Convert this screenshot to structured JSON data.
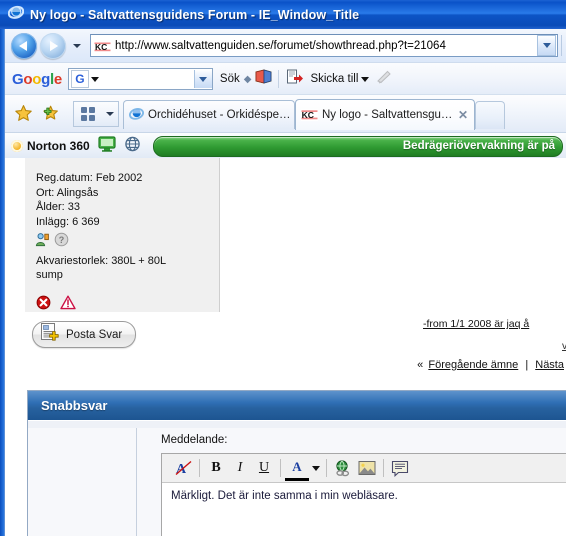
{
  "window": {
    "title": "Ny logo - Saltvattensguidens Forum - IE_Window_Title",
    "browser_icon": "internet-explorer-icon"
  },
  "navbar": {
    "back_label": "Back",
    "forward_label": "Forward",
    "history_label": "Recent pages",
    "url": "http://www.saltvattenguiden.se/forumet/showthread.php?t=21064",
    "favicon": "kc-favicon",
    "dropdown_label": "Address dropdown"
  },
  "google_toolbar": {
    "logo_letters": [
      "G",
      "o",
      "o",
      "g",
      "l",
      "e"
    ],
    "search_value": "",
    "search_placeholder": "",
    "search_engine_label": "G",
    "search_button": "Sök",
    "bookmarks_icon": "bookmarks-icon",
    "send_to_label": "Skicka till",
    "send_to_icon": "send-to-icon",
    "highlight_icon": "highlighter-icon"
  },
  "tabbar": {
    "favorites_icon": "star-icon",
    "add_favorite_icon": "add-star-icon",
    "quick_tabs_icon": "quick-tabs-grid-icon",
    "tab_list_icon": "chevron-down-icon",
    "tabs": [
      {
        "label": "Orchidéhuset - Orkidéspeciali...",
        "favicon": "internet-explorer-icon",
        "active": false,
        "close": ""
      },
      {
        "label": "Ny logo - Saltvattensguid...",
        "favicon": "kc-favicon",
        "active": true,
        "close": "✕"
      }
    ],
    "new_tab_label": ""
  },
  "norton": {
    "product": "Norton 360",
    "ring_icon": "norton-ring-icon",
    "computer_icon": "computer-monitor-icon",
    "web_icon": "globe-icon",
    "banner_text": "Bedrägeriövervakning är på",
    "banner_color": "#2f9a32"
  },
  "post": {
    "user_info": [
      "Reg.datum: Feb 2002",
      "Ort: Alingsås",
      "Ålder: 33",
      "Inlägg: 6 369"
    ],
    "profile_icon": "user-profile-icon",
    "help_icon": "help-question-icon",
    "aquarium_line1": "Akvariestorlek: 380L + 80L",
    "aquarium_line2": "sump",
    "error_icon": "error-x-icon",
    "warning_icon": "warning-triangle-icon",
    "signature": "-from 1/1 2008 är jaq å",
    "signature_more": "v"
  },
  "actions": {
    "post_reply_label": "Posta Svar",
    "post_reply_icon": "new-post-icon"
  },
  "thread_nav": {
    "prev_chevron": "«",
    "prev_label": "Föregående ämne",
    "divider": "|",
    "next_label": "Nästa"
  },
  "quick_reply": {
    "title": "Snabbsvar",
    "message_label": "Meddelande:",
    "toolbar": [
      {
        "name": "remove-format-icon",
        "glyph": "A"
      },
      {
        "name": "bold-icon",
        "glyph": "B"
      },
      {
        "name": "italic-icon",
        "glyph": "I"
      },
      {
        "name": "underline-icon",
        "glyph": "U"
      },
      {
        "name": "font-color-icon",
        "glyph": "A"
      },
      {
        "name": "font-color-dropdown-icon",
        "glyph": "▾"
      },
      {
        "name": "insert-link-icon",
        "glyph": ""
      },
      {
        "name": "insert-image-icon",
        "glyph": ""
      },
      {
        "name": "insert-quote-icon",
        "glyph": ""
      }
    ],
    "message_value": "Märkligt. Det är inte samma i min webläsare."
  }
}
